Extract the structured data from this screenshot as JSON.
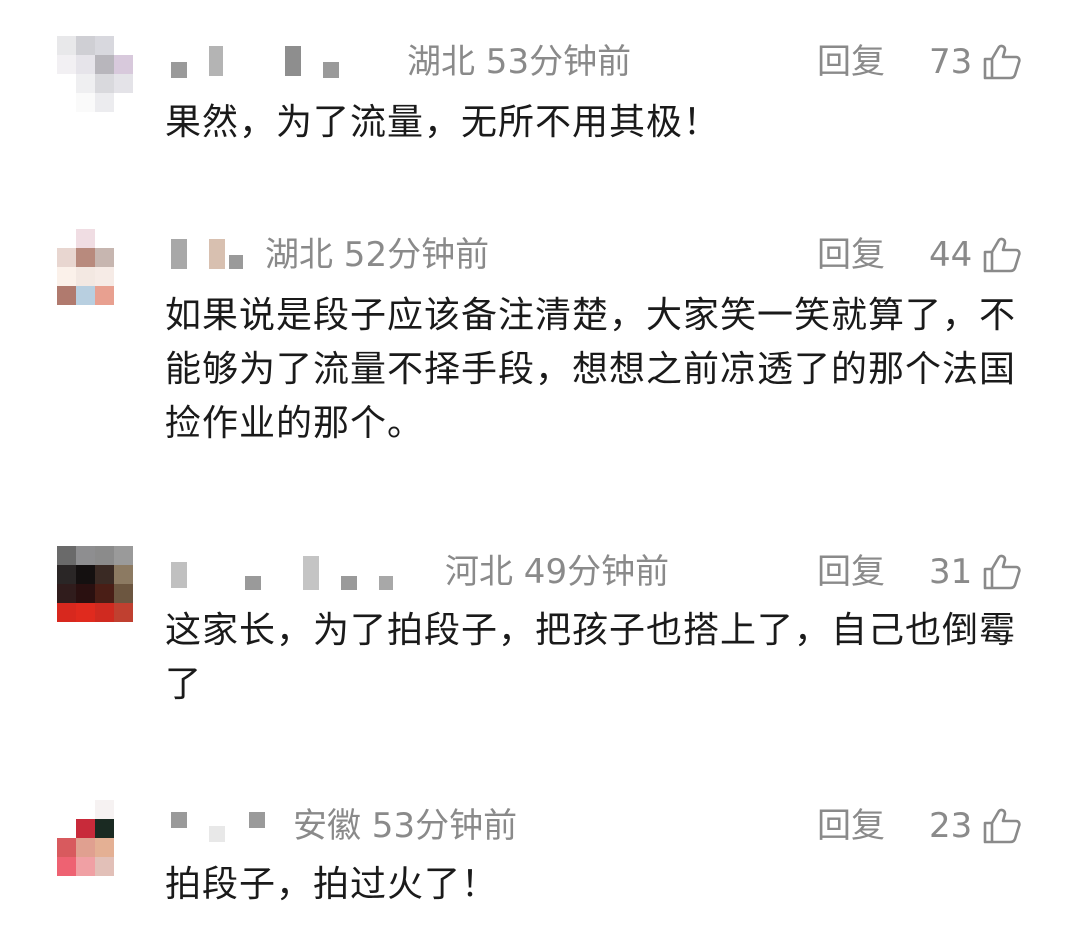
{
  "comments": [
    {
      "location_time": "湖北 53分钟前",
      "reply_label": "回复",
      "like_count": "73",
      "text": "果然，为了流量，无所不用其极！",
      "avatar_colors": [
        "#e8e8ea",
        "#cfcfd4",
        "#d8d8de",
        "#ffffff",
        "#f2f0f3",
        "#e6e4ea",
        "#b8b6bc",
        "#d8c9dc",
        "#ffffff",
        "#efeff1",
        "#d9d9dd",
        "#e4e3e8",
        "#ffffff",
        "#fafafa",
        "#ececef",
        "#ffffff"
      ]
    },
    {
      "location_time": "湖北 52分钟前",
      "reply_label": "回复",
      "like_count": "44",
      "text": "如果说是段子应该备注清楚，大家笑一笑就算了，不能够为了流量不择手段，想想之前凉透了的那个法国捡作业的那个。",
      "avatar_colors": [
        "#ffffff",
        "#f0dde3",
        "#ffffff",
        "#ffffff",
        "#e8d6d0",
        "#b88a7d",
        "#c7b6b0",
        "#ffffff",
        "#fbf1ea",
        "#f3e8e2",
        "#f6ebe6",
        "#ffffff",
        "#b07a6e",
        "#b8cfe0",
        "#e8a090",
        "#ffffff"
      ]
    },
    {
      "location_time": "河北 49分钟前",
      "reply_label": "回复",
      "like_count": "31",
      "text": "这家长，为了拍段子，把孩子也搭上了，自己也倒霉了",
      "avatar_colors": [
        "#6a6a6a",
        "#8e8e90",
        "#8b8b8b",
        "#9a9a9a",
        "#2a2626",
        "#141010",
        "#3a2a24",
        "#8c7a62",
        "#301c1c",
        "#2a1010",
        "#4a1e16",
        "#6c5640",
        "#d8281e",
        "#e02a1e",
        "#d02a20",
        "#c04030"
      ]
    },
    {
      "location_time": "安徽 53分钟前",
      "reply_label": "回复",
      "like_count": "23",
      "text": "拍段子，拍过火了！",
      "avatar_colors": [
        "#ffffff",
        "#ffffff",
        "#f6f2f2",
        "#ffffff",
        "#ffffff",
        "#c82a3a",
        "#1a2a22",
        "#ffffff",
        "#d85a5e",
        "#e0a090",
        "#e4b094",
        "#ffffff",
        "#ee6272",
        "#f0a0a4",
        "#e2c0b8",
        "#ffffff"
      ]
    }
  ]
}
